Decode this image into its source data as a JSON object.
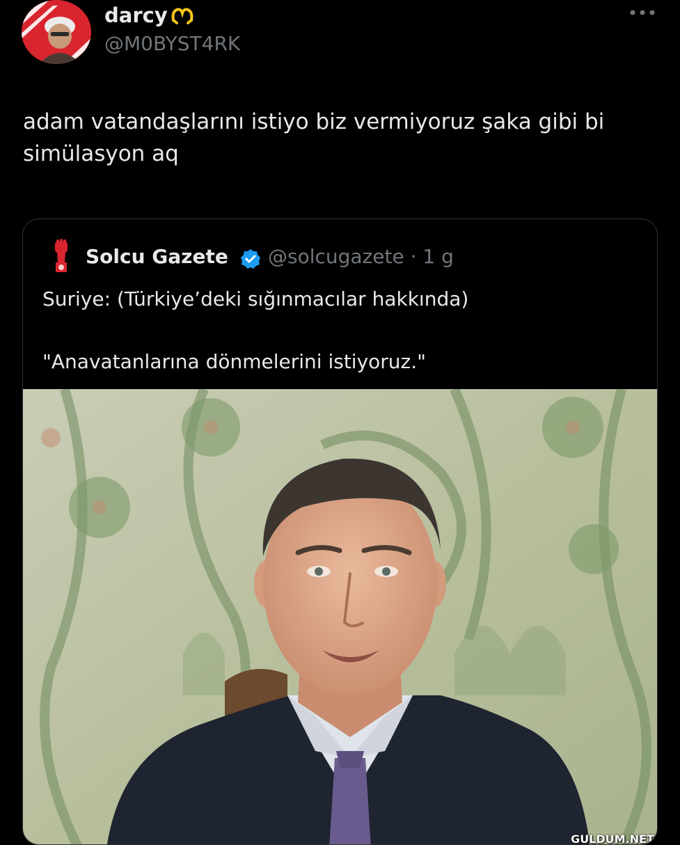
{
  "tweet": {
    "display_name": "darcy",
    "name_emoji": "heart-hands-emoji",
    "handle": "@M0BYST4RK",
    "text": "adam vatandaşlarını istiyo biz vermiyoruz şaka gibi bi simülasyon aq"
  },
  "quote": {
    "name": "Solcu Gazete",
    "handle_time": "@solcugazete · 1 g",
    "line1": "Suriye: (Türkiye’deki sığınmacılar hakkında)",
    "line2": "\"Anavatanlarına dönmelerini istiyoruz.\"",
    "media_description": "portrait-photo"
  },
  "watermark": "GULDUM.NET",
  "colors": {
    "background": "#000000",
    "text_primary": "#e7e9ea",
    "text_secondary": "#71767b",
    "border": "#2f3336",
    "verified": "#1d9bf0",
    "logo_red": "#d9252e"
  }
}
